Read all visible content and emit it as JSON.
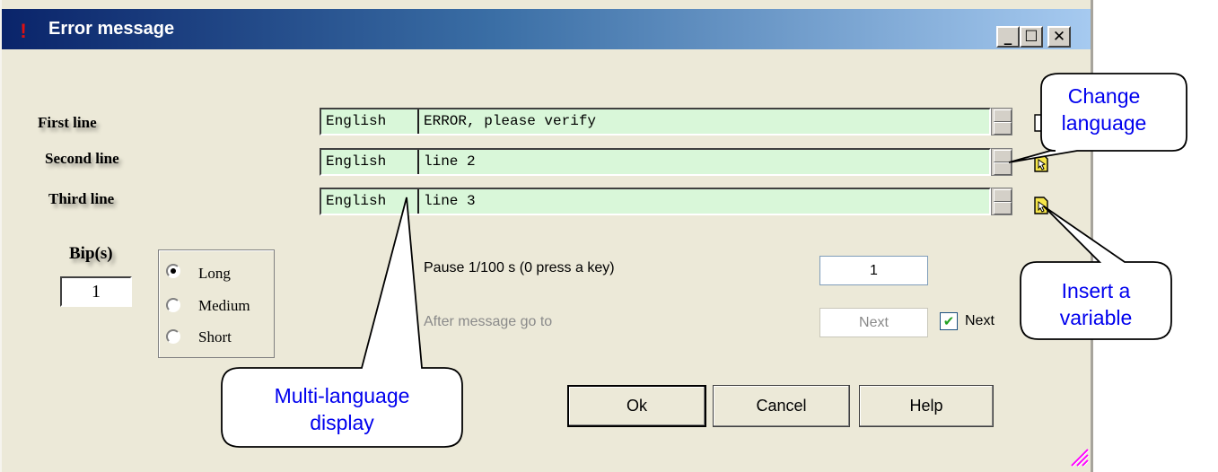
{
  "window": {
    "title": "Error message",
    "icon": "exclamation-icon",
    "controls": [
      "minimize-icon",
      "maximize-icon",
      "close-icon"
    ]
  },
  "lines": [
    {
      "label": "First line",
      "language": "English",
      "text": "ERROR, please verify"
    },
    {
      "label": "Second line",
      "language": "English",
      "text": "line 2"
    },
    {
      "label": "Third line",
      "language": "English",
      "text": "line 3"
    }
  ],
  "beeps": {
    "label": "Bip(s)",
    "value": "1",
    "options": [
      {
        "label": "Long",
        "selected": true
      },
      {
        "label": "Medium",
        "selected": false
      },
      {
        "label": "Short",
        "selected": false
      }
    ]
  },
  "pause": {
    "label": "Pause 1/100 s (0 press a key)",
    "value": "1"
  },
  "after_message": {
    "label": "After message go to",
    "value": "Next",
    "check_label": "Next",
    "checked": true
  },
  "buttons": {
    "ok": "Ok",
    "cancel": "Cancel",
    "help": "Help"
  },
  "callouts": {
    "change_language": [
      "Change",
      "language"
    ],
    "insert_variable": [
      "Insert a",
      "variable"
    ],
    "multi_language": [
      "Multi-language",
      "display"
    ]
  },
  "colors": {
    "field_bg": "#d9f7d9",
    "dialog_bg": "#ece9d8",
    "callout_text": "#0000ee"
  }
}
